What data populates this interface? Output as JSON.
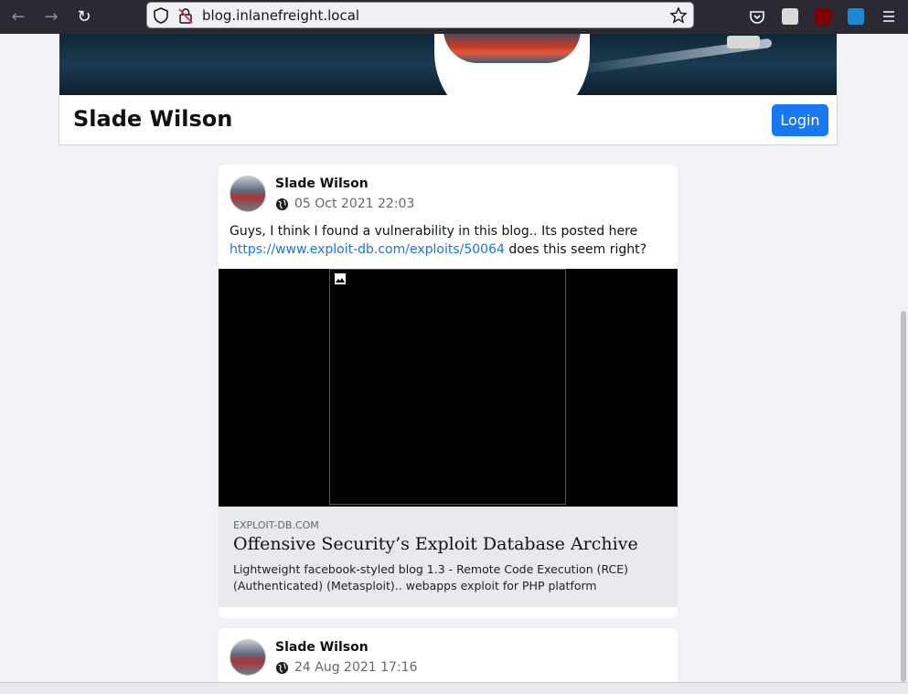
{
  "browser": {
    "url": "blog.inlanefreight.local"
  },
  "profile": {
    "name": "Slade Wilson",
    "login_label": "Login"
  },
  "posts": [
    {
      "author": "Slade Wilson",
      "date": "05 Oct 2021 22:03",
      "text_before": "Guys, I think I found a vulnerability in this blog.. Its posted here ",
      "link": "https://www.exploit-db.com/exploits/50064",
      "text_after": " does this seem right?",
      "preview": {
        "domain": "EXPLOIT-DB.COM",
        "title": "Offensive Security’s Exploit Database Archive",
        "description": "Lightweight facebook-styled blog 1.3 - Remote Code Execution (RCE) (Authenticated) (Metasploit).. webapps exploit for PHP platform"
      }
    },
    {
      "author": "Slade Wilson",
      "date": "24 Aug 2021 17:16"
    }
  ],
  "icons": {
    "back": "arrow-left-icon",
    "forward": "arrow-right-icon",
    "reload": "reload-icon",
    "shield": "shield-icon",
    "lock": "insecure-lock-icon",
    "star": "star-icon",
    "pocket": "pocket-icon",
    "menu": "hamburger-menu-icon",
    "globe": "globe-icon",
    "broken_image": "broken-image-icon"
  },
  "colors": {
    "accent": "#1877f2",
    "link": "#1a73e8",
    "toolbar": "#2b2a33",
    "page_bg": "#f0f2f5"
  }
}
